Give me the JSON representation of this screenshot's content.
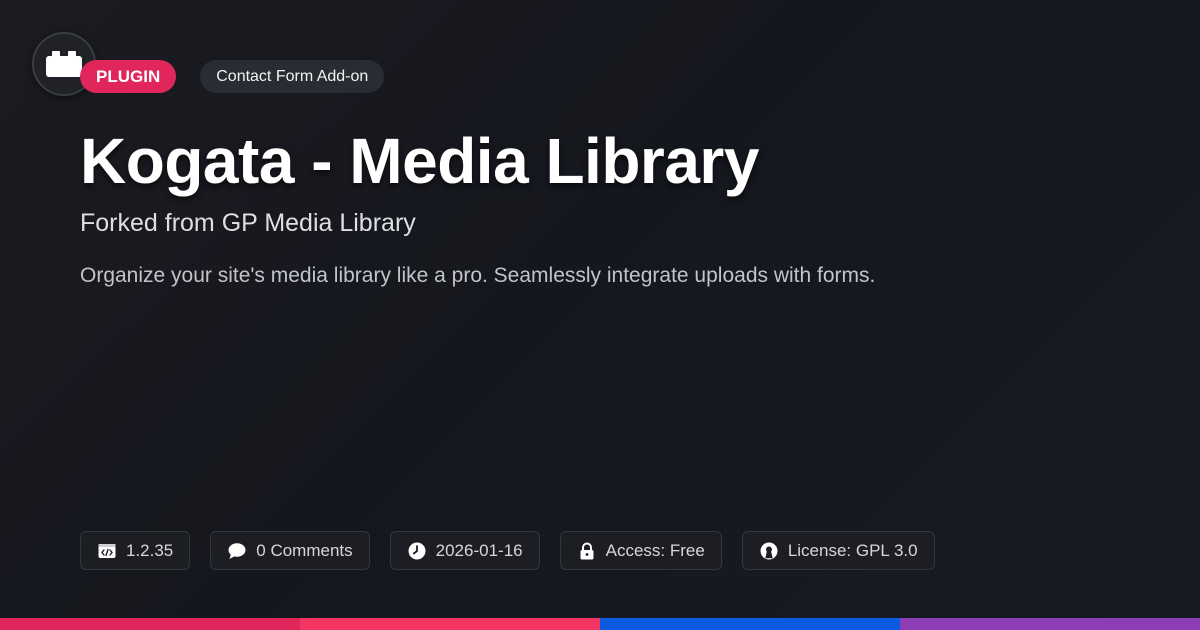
{
  "logo": {
    "icon": "brick-icon"
  },
  "badges": {
    "type": "PLUGIN",
    "category": "Contact Form Add-on"
  },
  "title": "Kogata - Media Library",
  "subtitle": "Forked from GP Media Library",
  "description": "Organize your site's media library like a pro. Seamlessly integrate uploads with forms.",
  "meta": [
    {
      "icon": "code-icon",
      "text": "1.2.35"
    },
    {
      "icon": "comment-icon",
      "text": "0 Comments"
    },
    {
      "icon": "clock-icon",
      "text": "2026-01-16"
    },
    {
      "icon": "lock-icon",
      "text": "Access: Free"
    },
    {
      "icon": "open-source-icon",
      "text": "License: GPL 3.0"
    }
  ],
  "colors": {
    "accent": "#e0265a",
    "bar": [
      "#e0265a",
      "#f23563",
      "#0b5ae0",
      "#8e3eb5"
    ]
  }
}
